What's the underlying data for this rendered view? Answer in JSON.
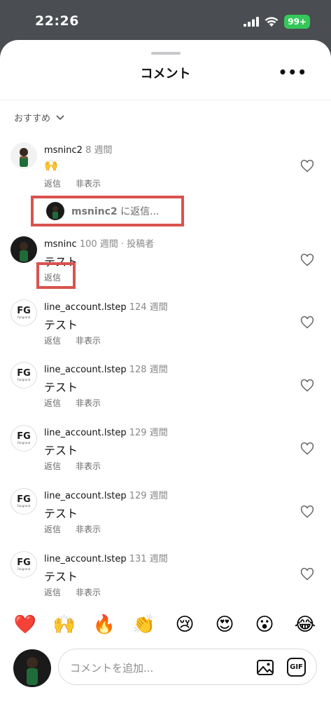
{
  "status": {
    "time": "22:26",
    "battery": "99+"
  },
  "sheet": {
    "title": "コメント",
    "more": "•••"
  },
  "sort": {
    "label": "おすすめ"
  },
  "reply_prompt": {
    "username": "msninc2",
    "suffix": " に返信..."
  },
  "comments": [
    {
      "username": "msninc2",
      "meta": " 8 週間",
      "text": "🙌",
      "reply": "返信",
      "hide": "非表示",
      "avatar": "person"
    },
    {
      "username": "msninc",
      "meta": " 100 週間 · 投稿者",
      "text": "テスト",
      "reply": "返信",
      "hide": "",
      "avatar": "dark"
    },
    {
      "username": "line_account.lstep",
      "meta": " 124 週間",
      "text": "テスト",
      "reply": "返信",
      "hide": "非表示",
      "avatar": "FG"
    },
    {
      "username": "line_account.lstep",
      "meta": " 128 週間",
      "text": "テスト",
      "reply": "返信",
      "hide": "非表示",
      "avatar": "FG"
    },
    {
      "username": "line_account.lstep",
      "meta": " 129 週間",
      "text": "テスト",
      "reply": "返信",
      "hide": "非表示",
      "avatar": "FG"
    },
    {
      "username": "line_account.lstep",
      "meta": " 129 週間",
      "text": "テスト",
      "reply": "返信",
      "hide": "非表示",
      "avatar": "FG"
    },
    {
      "username": "line_account.lstep",
      "meta": " 131 週間",
      "text": "テスト",
      "reply": "返信",
      "hide": "非表示",
      "avatar": "FG"
    }
  ],
  "fg_logo": {
    "text": "FG",
    "sub": "Fangrand"
  },
  "emojis": [
    "❤️",
    "🙌",
    "🔥",
    "👏",
    "😢",
    "😍",
    "😮",
    "😂"
  ],
  "composer": {
    "placeholder": "コメントを追加...",
    "gif": "GIF"
  },
  "colors": {
    "highlight": "#d9534f",
    "status_bg": "#4a4d51",
    "battery": "#34c759"
  }
}
